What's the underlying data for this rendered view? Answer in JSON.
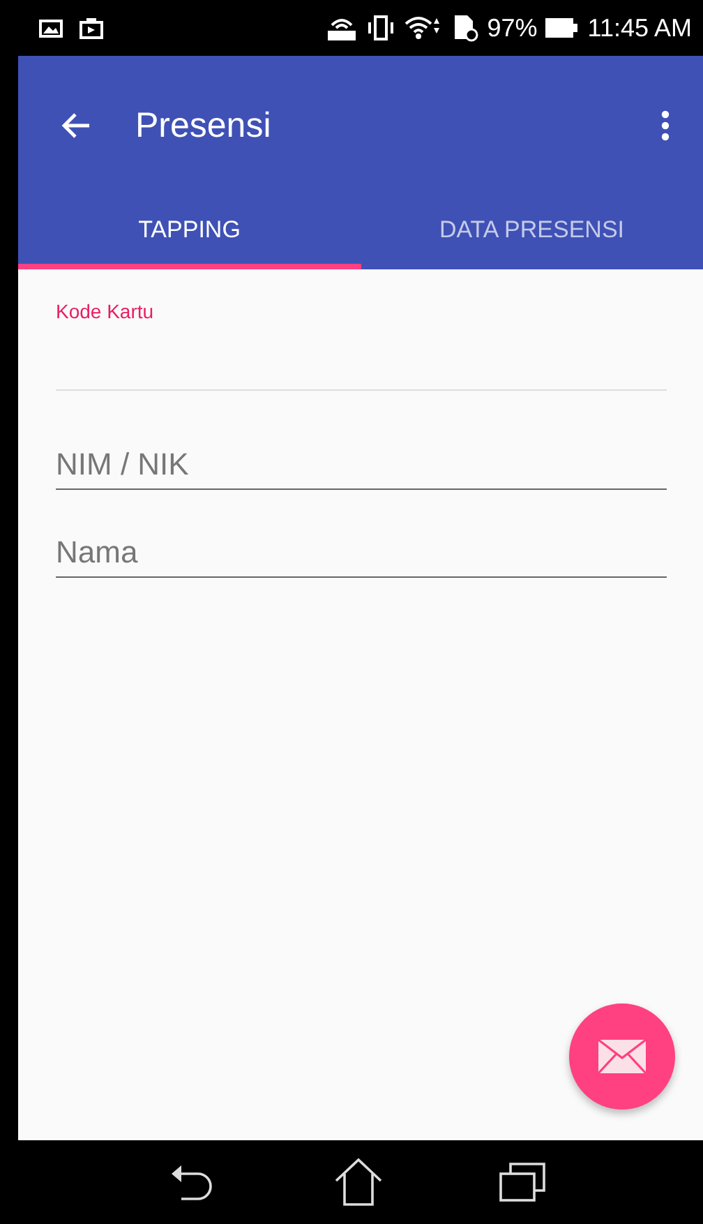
{
  "status_bar": {
    "battery": "97%",
    "time": "11:45 AM"
  },
  "app_bar": {
    "title": "Presensi"
  },
  "tabs": [
    {
      "label": "TAPPING",
      "selected": true
    },
    {
      "label": "DATA PRESENSI",
      "selected": false
    }
  ],
  "fields": [
    {
      "kind": "floating",
      "label": "Kode Kartu"
    },
    {
      "kind": "hint",
      "placeholder": "NIM / NIK"
    },
    {
      "kind": "hint",
      "placeholder": "Nama"
    }
  ]
}
